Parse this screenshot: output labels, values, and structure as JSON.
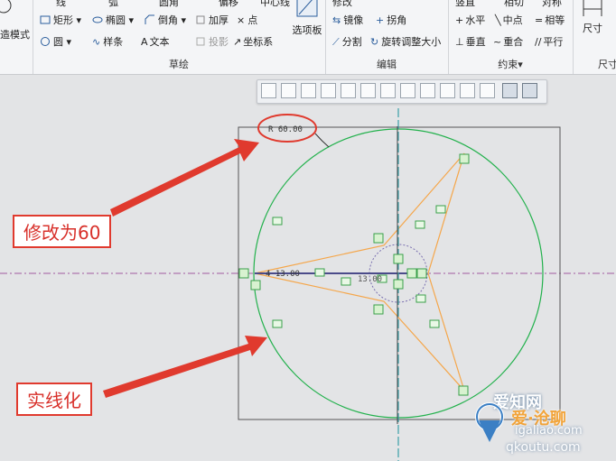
{
  "ribbon": {
    "mode_label": "造模式",
    "sketch": {
      "row1": [
        "线",
        "弧",
        "圆角",
        "偏移",
        "中心线"
      ],
      "rect": "矩形",
      "ellipse": "椭圆",
      "chamfer": "倒角",
      "thicken": "加厚",
      "point": "点",
      "circle": "圆",
      "spline": "样条",
      "text": "文本",
      "project": "投影",
      "coordsys": "坐标系",
      "palette": "选项板",
      "group_label": "草绘"
    },
    "edit": {
      "row1": "修改",
      "mirror": "镜像",
      "divide": "拐角",
      "split": "分割",
      "rotate_resize": "旋转调整大小",
      "group_label": "编辑"
    },
    "constrain": {
      "row1": [
        "竖直",
        "相切",
        "对称"
      ],
      "horizontal": "水平",
      "midpoint": "中点",
      "equal": "相等",
      "perpendicular": "垂直",
      "coincident": "重合",
      "parallel": "平行",
      "group_label": "约束▾"
    },
    "dimension": {
      "button": "尺寸",
      "group_label": "尺寸"
    }
  },
  "view_toolbar": {
    "icons": [
      "refit-icon",
      "zoom-in-icon",
      "zoom-out-icon",
      "repaint-icon",
      "display-style-icon",
      "saved-views-icon",
      "view-manager-icon",
      "datum-display-icon",
      "spin-center-icon",
      "annotation-icon",
      "point-display-icon",
      "sketch-view-icon",
      "disp-constraints-icon",
      "disp-vertices-icon"
    ]
  },
  "sketch": {
    "radius_dim": "R 60.00",
    "length_dim": "4 13.00",
    "small_dim": "13.00",
    "circle_color": "#22b14c",
    "construction_color": "#f5a64a",
    "axis_color": "#3aa0a8",
    "hline_color": "#a05aa0"
  },
  "callouts": {
    "modify": "修改为60",
    "solid": "实线化"
  },
  "watermark": {
    "line1": "爱知网",
    "line2": "爱·沧聊",
    "line3": "igaliao.com",
    "line4": "qkoutu.com"
  }
}
